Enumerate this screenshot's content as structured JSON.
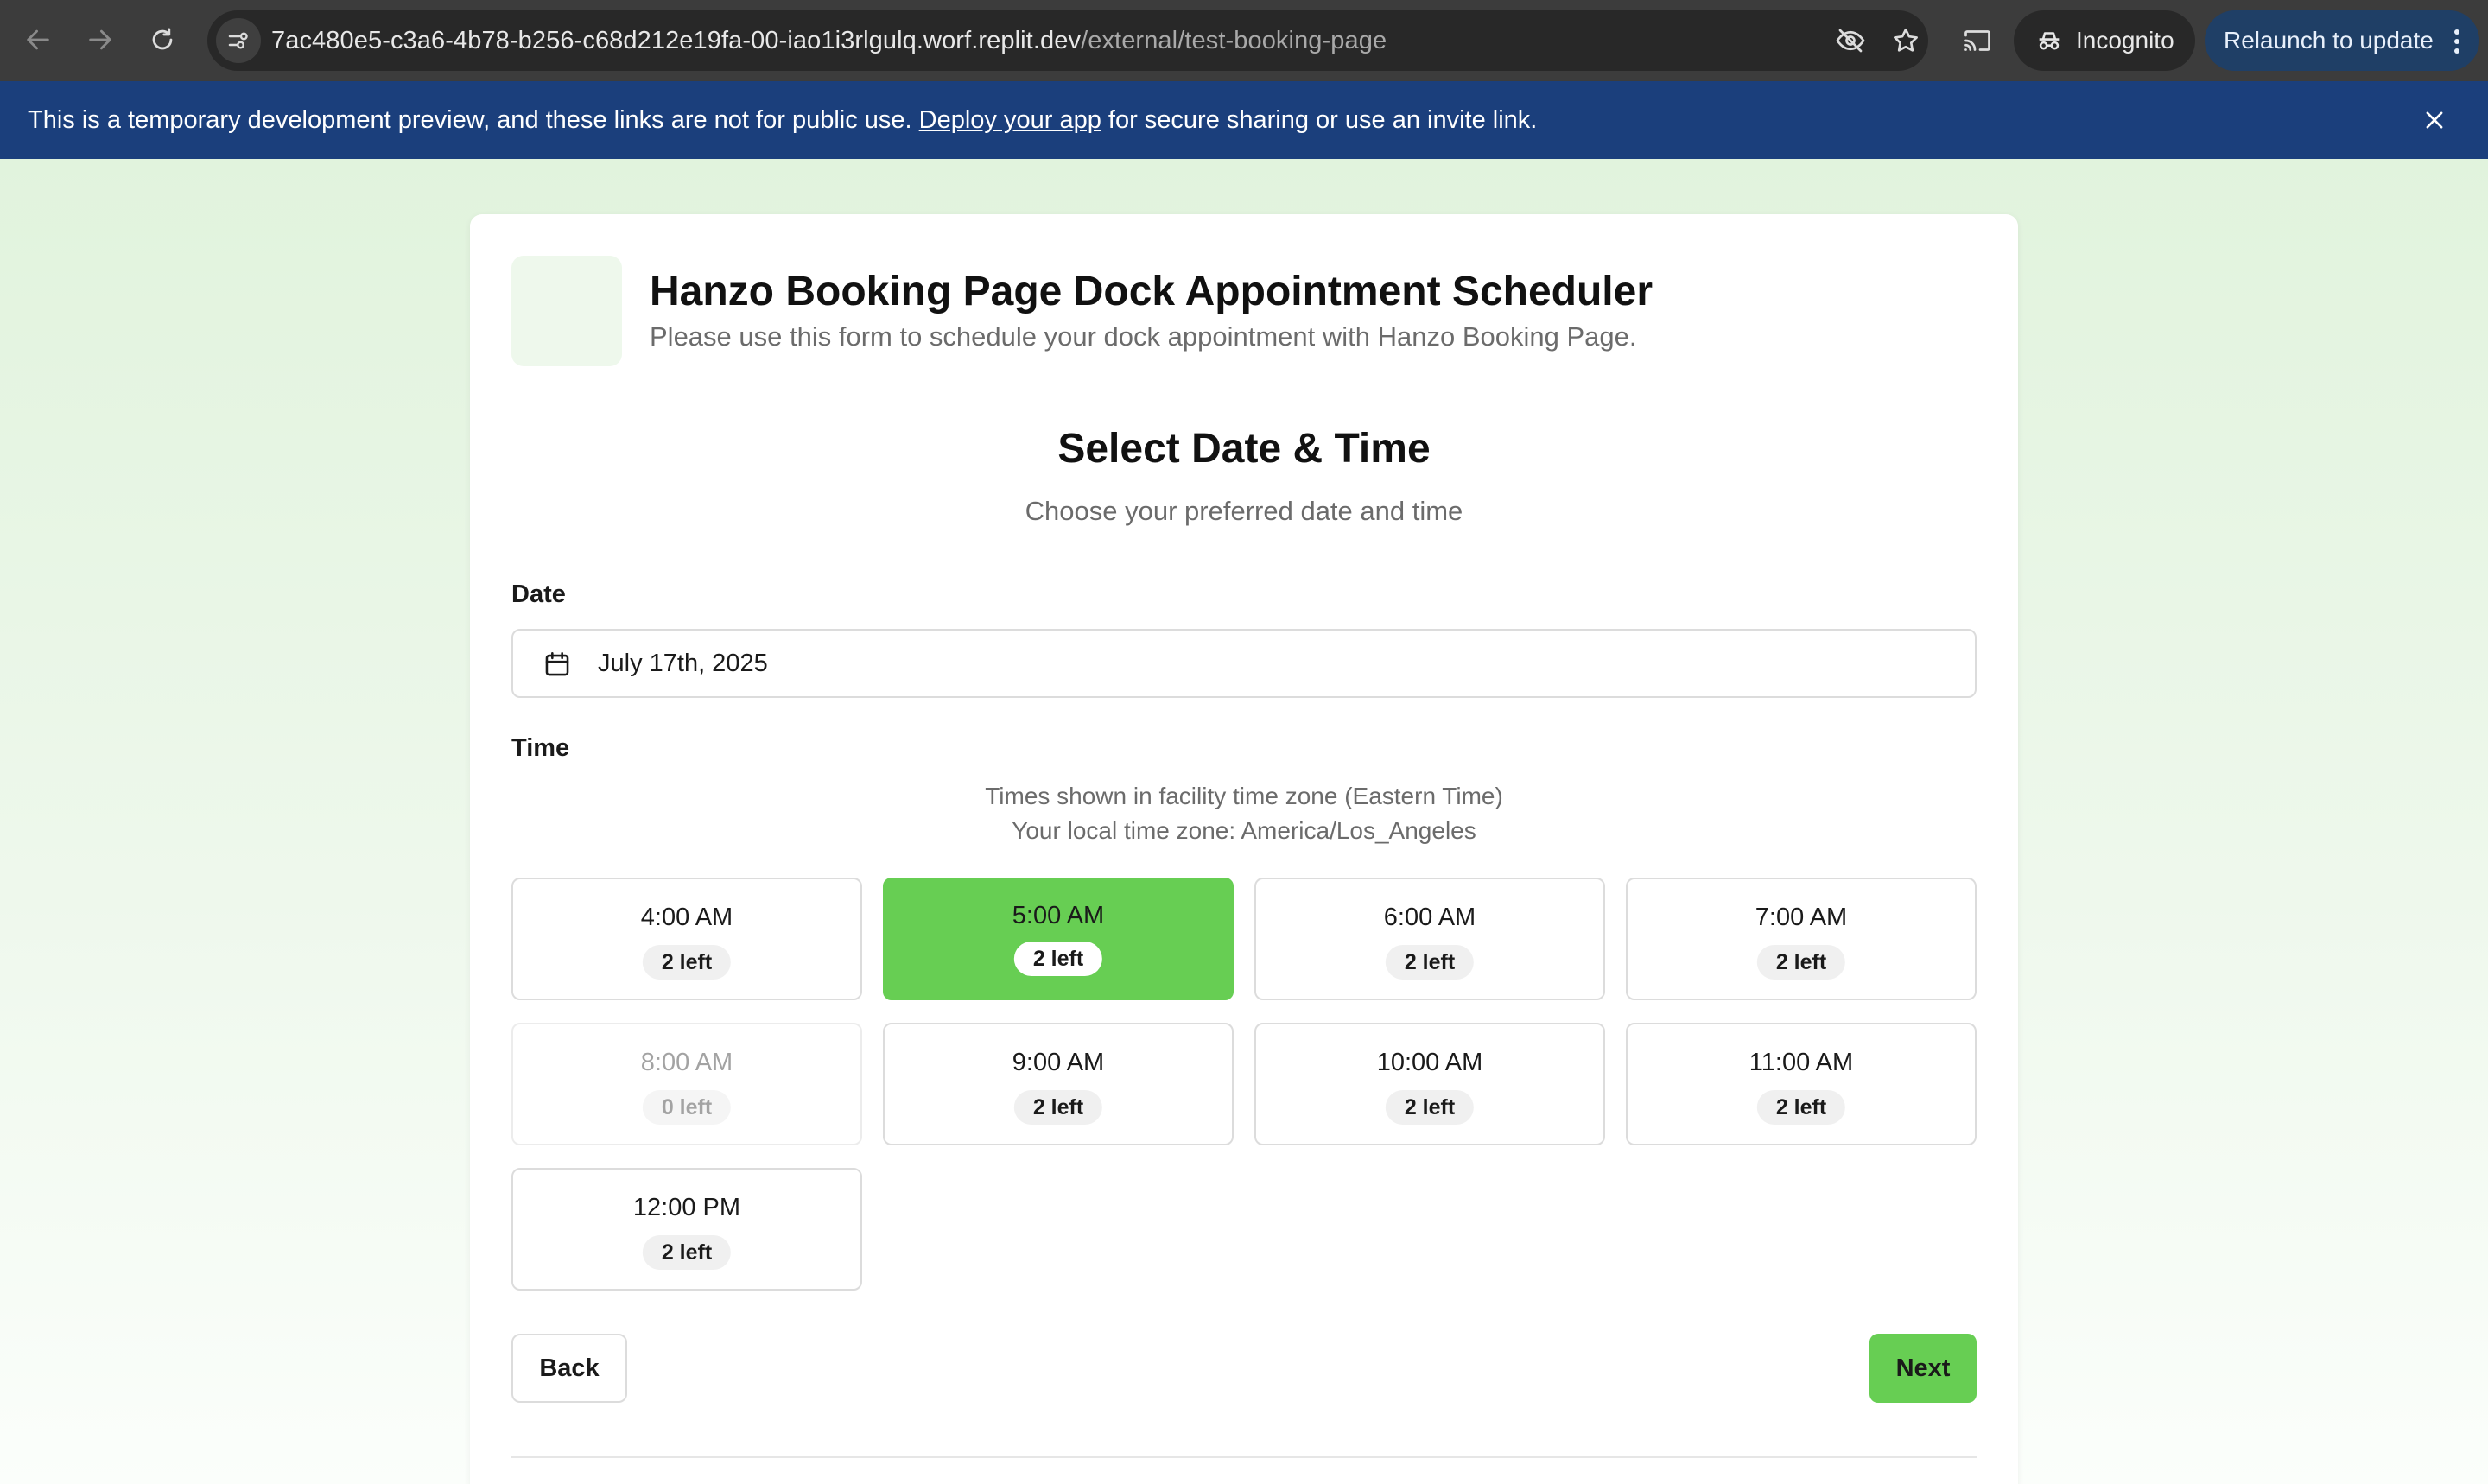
{
  "browser": {
    "url_host": "7ac480e5-c3a6-4b78-b256-c68d212e19fa-00-iao1i3rlgulq.worf.replit.dev",
    "url_path": "/external/test-booking-page",
    "incognito_label": "Incognito",
    "relaunch_label": "Relaunch to update",
    "icons": [
      "back-arrow-icon",
      "forward-arrow-icon",
      "reload-icon",
      "site-info-icon",
      "eye-off-icon",
      "star-icon",
      "cast-icon",
      "incognito-icon",
      "more-vert-icon"
    ]
  },
  "banner": {
    "text_before": "This is a temporary development preview, and these links are not for public use. ",
    "link_text": "Deploy your app",
    "text_after": " for secure sharing or use an invite link.",
    "close_icon": "close-icon"
  },
  "header": {
    "title": "Hanzo Booking Page Dock Appointment Scheduler",
    "subtitle": "Please use this form to schedule your dock appointment with Hanzo Booking Page."
  },
  "step": {
    "title": "Select Date & Time",
    "subtitle": "Choose your preferred date and time"
  },
  "date": {
    "label": "Date",
    "value": "July 17th, 2025",
    "icon": "calendar-icon"
  },
  "time": {
    "label": "Time",
    "tz_facility": "Times shown in facility time zone (Eastern Time)",
    "tz_local": "Your local time zone: America/Los_Angeles",
    "slots": [
      {
        "time": "4:00 AM",
        "left": "2 left",
        "state": "available"
      },
      {
        "time": "5:00 AM",
        "left": "2 left",
        "state": "selected"
      },
      {
        "time": "6:00 AM",
        "left": "2 left",
        "state": "available"
      },
      {
        "time": "7:00 AM",
        "left": "2 left",
        "state": "available"
      },
      {
        "time": "8:00 AM",
        "left": "0 left",
        "state": "disabled"
      },
      {
        "time": "9:00 AM",
        "left": "2 left",
        "state": "available"
      },
      {
        "time": "10:00 AM",
        "left": "2 left",
        "state": "available"
      },
      {
        "time": "11:00 AM",
        "left": "2 left",
        "state": "available"
      },
      {
        "time": "12:00 PM",
        "left": "2 left",
        "state": "available"
      }
    ]
  },
  "actions": {
    "back_label": "Back",
    "next_label": "Next"
  },
  "colors": {
    "accent": "#67ce53",
    "banner": "#1b3f7c",
    "chrome": "#3c3c3c"
  }
}
